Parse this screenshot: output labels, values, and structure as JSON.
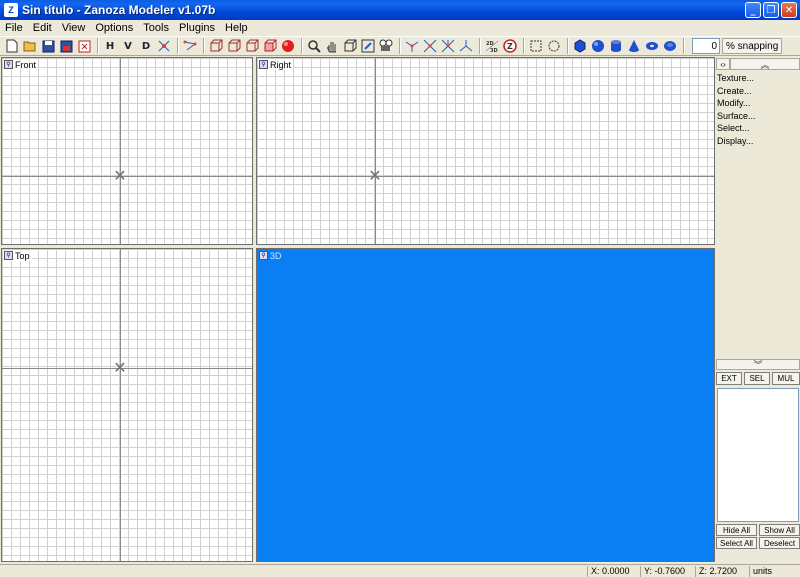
{
  "window": {
    "icon_text": "Z",
    "title": "Sin título - Zanoza Modeler v1.07b",
    "minimize": "_",
    "maximize": "❐",
    "close": "✕"
  },
  "menu": [
    "File",
    "Edit",
    "View",
    "Options",
    "Tools",
    "Plugins",
    "Help"
  ],
  "toolbar": {
    "h_label": "H",
    "v_label": "V",
    "d_label": "D",
    "snap_value": "0",
    "snap_label": "% snapping",
    "icons": [
      "new-file-icon",
      "open-folder-icon",
      "save-icon",
      "save-as-icon",
      "export-icon",
      "horizontal-view-icon",
      "vertical-view-icon",
      "diagonal-view-icon",
      "texture-random-icon",
      "select-points-icon",
      "box-front-icon",
      "box-side-icon",
      "box-back-icon",
      "box-red-icon",
      "sphere-red-icon",
      "zoom-icon",
      "hand-pan-icon",
      "box-outline-icon",
      "frame-icon",
      "camera-icon",
      "star-move-icon",
      "rotate-cross-icon",
      "scale-cross-icon",
      "axis-tri-icon",
      "2d-3d-toggle-icon",
      "z-axis-icon",
      "rect-select-icon",
      "circle-select-icon",
      "cylinder-blue-icon",
      "sphere-blue-icon",
      "tube-blue-icon",
      "cone-blue-icon",
      "torus-blue-icon",
      "disc-blue-icon"
    ]
  },
  "viewports": {
    "front": "Front",
    "right": "Right",
    "top": "Top",
    "persp": "3D"
  },
  "panel": {
    "left_arrow": "‹›",
    "up_arrow": "︽",
    "down_arrow": "︾",
    "menu": [
      "Texture...",
      "Create...",
      "Modify...",
      "Surface...",
      "Select...",
      "Display..."
    ],
    "modes": [
      "EXT",
      "SEL",
      "MUL"
    ],
    "hide_all": "Hide All",
    "show_all": "Show All",
    "select_all": "Select All",
    "deselect": "Deselect"
  },
  "status": {
    "x": "X: 0.0000",
    "y": "Y: -0.7600",
    "z": "Z: 2.7200",
    "units": "units"
  },
  "colors": {
    "viewport_3d": "#0a7ff4",
    "titlebar": "#0048d8"
  }
}
